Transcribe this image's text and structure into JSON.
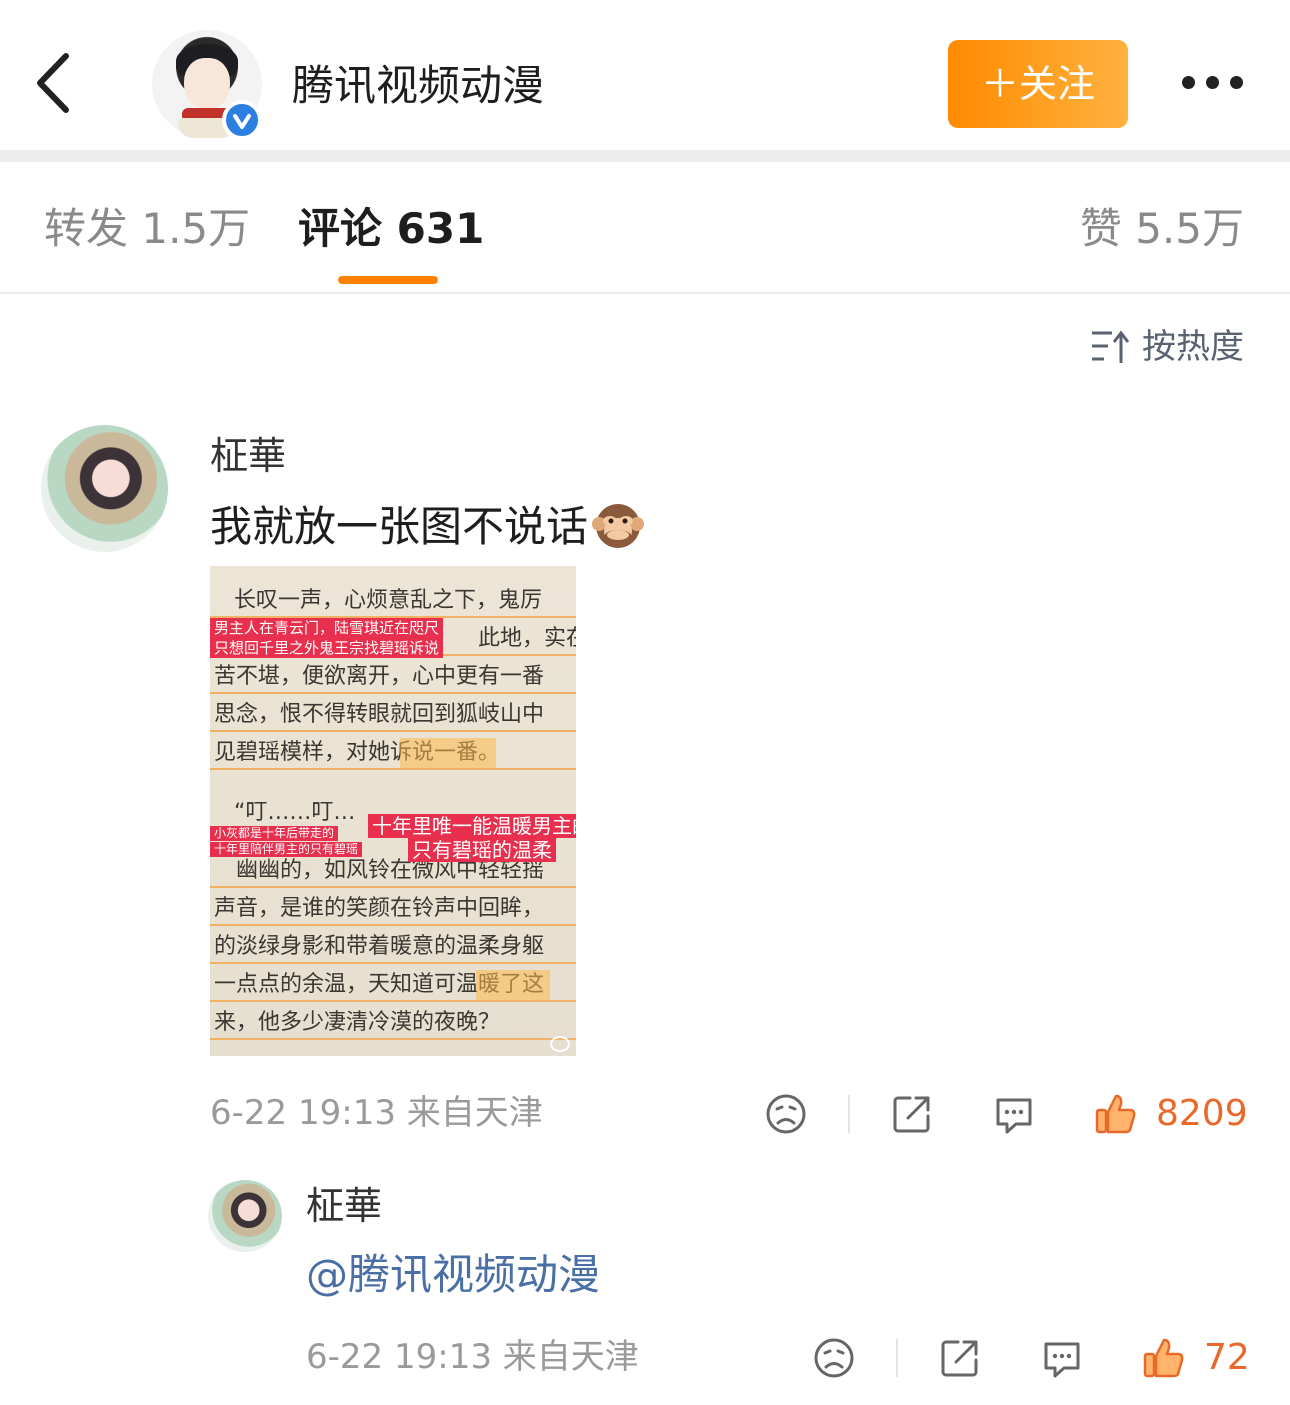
{
  "header": {
    "title": "腾讯视频动漫",
    "follow_label": "＋关注",
    "avatar_icon": "anime-boy-avatar",
    "verified_icon": "verified-v-icon",
    "back_icon": "chevron-left-icon",
    "more_icon": "more-dots-icon"
  },
  "tabs": {
    "reposts": "转发 1.5万",
    "comments": "评论 631",
    "likes": "赞 5.5万",
    "active": "comments",
    "accent": "#ff8200"
  },
  "sort": {
    "label": "按热度",
    "icon": "sort-up-icon"
  },
  "comment": {
    "username": "柾華",
    "text": "我就放一张图不说话",
    "emoji": "see-no-evil-monkey-emoji",
    "image": {
      "lines": [
        "长叹一声，心烦意乱之下，鬼厉",
        "此地，实在",
        "苦不堪，便欲离开，心中更有一番",
        "思念，恨不得转眼就回到狐岐山中",
        "见碧瑶模样，对她诉说一番。",
        "“叮……叮…",
        "幽幽的，如风铃在微风中轻轻摇",
        "声音，是谁的笑颜在铃声中回眸，",
        "的淡绿身影和带着暖意的温柔身躯",
        "一点点的余温，天知道可温暖了这",
        "来，他多少凄清冷漠的夜晚？"
      ],
      "tags": [
        "男主人在青云门，陆雪琪近在咫尺",
        "只想回千里之外鬼王宗找碧瑶诉说",
        "小灰都是十年后带走的",
        "十年里陪伴男主的只有碧瑶",
        "十年里唯一能温暖男主的",
        "只有碧瑶的温柔"
      ]
    },
    "time": "6-22 19:13",
    "location": "来自天津",
    "like_count": "8209",
    "like_color": "#e8692a"
  },
  "reply": {
    "username": "柾華",
    "text": "@腾讯视频动漫",
    "time": "6-22 19:13",
    "location": "来自天津",
    "like_count": "72",
    "mention_color": "#4a6fa5"
  }
}
